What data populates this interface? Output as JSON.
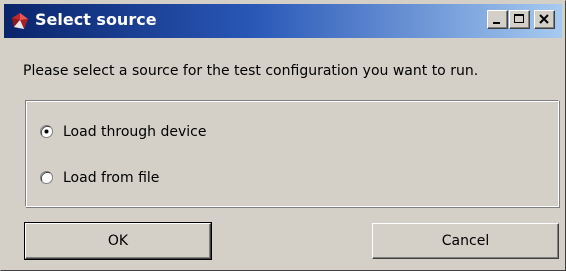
{
  "window": {
    "title": "Select source"
  },
  "title_buttons": {
    "minimize_icon": "minimize-icon",
    "maximize_icon": "maximize-icon",
    "close_icon": "close-icon"
  },
  "prompt": "Please select a source for the test configuration you want to run.",
  "source_options": [
    {
      "label": "Load through device",
      "selected": true
    },
    {
      "label": "Load from file",
      "selected": false
    }
  ],
  "buttons": {
    "ok": "OK",
    "cancel": "Cancel"
  },
  "colors": {
    "titlebar_start": "#0a246a",
    "titlebar_end": "#a6caf0",
    "face": "#d4d0c8"
  }
}
